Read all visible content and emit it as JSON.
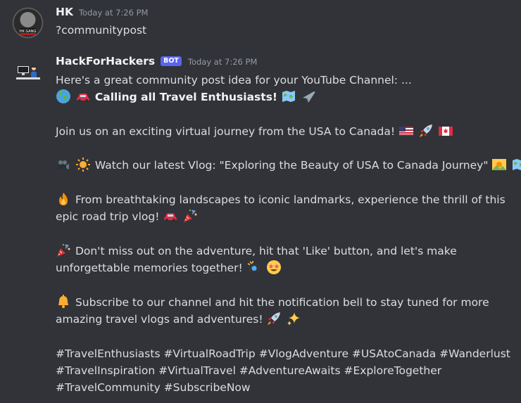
{
  "messages": [
    {
      "author": "HK",
      "timestamp": "Today at 7:26 PM",
      "content": "?communitypost"
    },
    {
      "author": "HackForHackers",
      "tag": "BOT",
      "timestamp": "Today at 7:26 PM",
      "intro": "Here's a great community post idea for your YouTube Channel: ...",
      "headline": "Calling all Travel Enthusiasts!",
      "join": "Join us on an exciting virtual journey from the USA to Canada!",
      "watch": "Watch our latest Vlog: \"Exploring the Beauty of USA to Canada Journey\"",
      "landscapes_1": "From breathtaking landscapes to iconic landmarks, experience the thrill of this",
      "landscapes_2": "epic road trip vlog!",
      "dontmiss_1": "Don't miss out on the adventure, hit that 'Like' button, and let's make",
      "dontmiss_2": "unforgettable memories together!",
      "subscribe_1": "Subscribe to our channel and hit the notification bell to stay tuned for more",
      "subscribe_2": "amazing travel vlogs and adventures!",
      "hashtags_1": "#TravelEnthusiasts #VirtualRoadTrip #VlogAdventure #USAtoCanada #Wanderlust",
      "hashtags_2": "#TravelInspiration #VirtualTravel #AdventureAwaits #ExploreTogether",
      "hashtags_3": "#TravelCommunity #SubscribeNow"
    }
  ],
  "icons": [
    "globe-icon",
    "car-icon",
    "map-icon",
    "airplane-icon",
    "us-flag-icon",
    "rocket-icon",
    "canada-flag-icon",
    "video-camera-icon",
    "sun-icon",
    "sunrise-icon",
    "fire-icon",
    "party-popper-icon",
    "camera-flash-icon",
    "star-struck-icon",
    "bell-icon",
    "sparkles-icon"
  ]
}
